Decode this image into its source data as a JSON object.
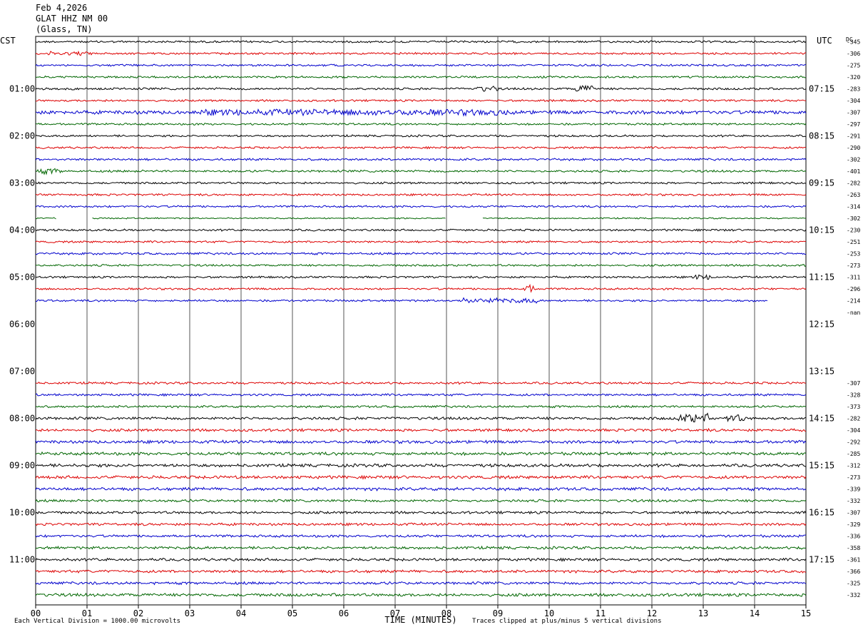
{
  "header": {
    "date": "Feb 4,2026",
    "station": "GLAT HHZ NM 00",
    "location": "(Glass, TN)"
  },
  "left_tz": "CST",
  "right_tz": "UTC",
  "dc_label": "DC",
  "chart_data": {
    "type": "line",
    "title": "",
    "xlabel": "TIME (MINUTES)",
    "x_ticks": [
      "00",
      "01",
      "02",
      "03",
      "04",
      "05",
      "06",
      "07",
      "08",
      "09",
      "10",
      "11",
      "12",
      "13",
      "14",
      "15"
    ],
    "xlim": [
      0,
      15
    ],
    "rows_per_hour": 4,
    "minutes_per_row": 15,
    "left_hour_labels": [
      "01:00",
      "02:00",
      "03:00",
      "04:00",
      "05:00",
      "06:00",
      "07:00",
      "08:00",
      "09:00",
      "10:00",
      "11:00"
    ],
    "right_hour_labels": [
      "07:15",
      "08:15",
      "09:15",
      "10:15",
      "11:15",
      "12:15",
      "13:15",
      "14:15",
      "15:15",
      "16:15",
      "17:15"
    ],
    "trace_colors": [
      "#000000",
      "#dd0000",
      "#0000cc",
      "#006600"
    ],
    "rows": [
      {
        "dc": "-345",
        "color": "#000000",
        "amp": 1.2,
        "end": 15
      },
      {
        "dc": "-306",
        "color": "#dd0000",
        "amp": 1.2,
        "end": 15,
        "events": [
          [
            0.6,
            0.5,
            2.0
          ]
        ]
      },
      {
        "dc": "-275",
        "color": "#0000cc",
        "amp": 1.2,
        "end": 15
      },
      {
        "dc": "-320",
        "color": "#006600",
        "amp": 1.2,
        "end": 15
      },
      {
        "dc": "-283",
        "color": "#000000",
        "amp": 1.3,
        "end": 15,
        "events": [
          [
            8.8,
            0.2,
            2.5
          ],
          [
            10.7,
            0.2,
            3.5
          ]
        ]
      },
      {
        "dc": "-304",
        "color": "#dd0000",
        "amp": 1.2,
        "end": 15
      },
      {
        "dc": "-307",
        "color": "#0000cc",
        "amp": 2.2,
        "end": 15,
        "events": [
          [
            6.2,
            3.0,
            1.7
          ]
        ]
      },
      {
        "dc": "-297",
        "color": "#006600",
        "amp": 1.2,
        "end": 15
      },
      {
        "dc": "-291",
        "color": "#000000",
        "amp": 1.2,
        "end": 15
      },
      {
        "dc": "-290",
        "color": "#dd0000",
        "amp": 1.2,
        "end": 15
      },
      {
        "dc": "-302",
        "color": "#0000cc",
        "amp": 1.3,
        "end": 15
      },
      {
        "dc": "-401",
        "color": "#006600",
        "amp": 1.3,
        "end": 15,
        "events": [
          [
            0.2,
            0.3,
            2.5
          ]
        ]
      },
      {
        "dc": "-282",
        "color": "#000000",
        "amp": 1.2,
        "end": 15
      },
      {
        "dc": "-263",
        "color": "#dd0000",
        "amp": 1.2,
        "end": 15
      },
      {
        "dc": "-314",
        "color": "#0000cc",
        "amp": 1.2,
        "end": 15
      },
      {
        "dc": "-302",
        "color": "#006600",
        "amp": 0.8,
        "end": 15,
        "gaps": [
          [
            0.4,
            1.1
          ],
          [
            8.0,
            8.7
          ]
        ]
      },
      {
        "dc": "-230",
        "color": "#000000",
        "amp": 1.2,
        "end": 15
      },
      {
        "dc": "-251",
        "color": "#dd0000",
        "amp": 1.2,
        "end": 15
      },
      {
        "dc": "-253",
        "color": "#0000cc",
        "amp": 1.3,
        "end": 15
      },
      {
        "dc": "-273",
        "color": "#006600",
        "amp": 1.2,
        "end": 15
      },
      {
        "dc": "-311",
        "color": "#000000",
        "amp": 1.2,
        "end": 15,
        "events": [
          [
            13.0,
            0.2,
            2.5
          ]
        ]
      },
      {
        "dc": "-296",
        "color": "#dd0000",
        "amp": 1.2,
        "end": 15,
        "events": [
          [
            9.6,
            0.1,
            4.0
          ]
        ]
      },
      {
        "dc": "-214",
        "color": "#0000cc",
        "amp": 1.2,
        "end": 14.25,
        "events": [
          [
            9.0,
            0.8,
            2.5
          ]
        ]
      },
      {
        "dc": "-nan",
        "color": "#006600",
        "amp": 0,
        "end": 0
      },
      {
        "dc": "",
        "color": "#000000",
        "amp": 0,
        "end": 0
      },
      {
        "dc": "",
        "color": "#dd0000",
        "amp": 0,
        "end": 0
      },
      {
        "dc": "",
        "color": "#0000cc",
        "amp": 0,
        "end": 0
      },
      {
        "dc": "",
        "color": "#006600",
        "amp": 0,
        "end": 0
      },
      {
        "dc": "",
        "color": "#000000",
        "amp": 0,
        "end": 0
      },
      {
        "dc": "-307",
        "color": "#dd0000",
        "amp": 1.3,
        "end": 15
      },
      {
        "dc": "-328",
        "color": "#0000cc",
        "amp": 1.3,
        "end": 15
      },
      {
        "dc": "-373",
        "color": "#006600",
        "amp": 1.3,
        "end": 15
      },
      {
        "dc": "-282",
        "color": "#000000",
        "amp": 1.6,
        "end": 15,
        "events": [
          [
            12.8,
            0.3,
            3.5
          ],
          [
            13.6,
            0.2,
            3.0
          ]
        ]
      },
      {
        "dc": "-304",
        "color": "#dd0000",
        "amp": 1.6,
        "end": 15
      },
      {
        "dc": "-292",
        "color": "#0000cc",
        "amp": 1.8,
        "end": 15
      },
      {
        "dc": "-285",
        "color": "#006600",
        "amp": 1.8,
        "end": 15
      },
      {
        "dc": "-312",
        "color": "#000000",
        "amp": 1.8,
        "end": 15
      },
      {
        "dc": "-273",
        "color": "#dd0000",
        "amp": 1.8,
        "end": 15
      },
      {
        "dc": "-339",
        "color": "#0000cc",
        "amp": 1.8,
        "end": 15
      },
      {
        "dc": "-332",
        "color": "#006600",
        "amp": 1.5,
        "end": 15
      },
      {
        "dc": "-307",
        "color": "#000000",
        "amp": 1.5,
        "end": 15
      },
      {
        "dc": "-329",
        "color": "#dd0000",
        "amp": 1.5,
        "end": 15
      },
      {
        "dc": "-336",
        "color": "#0000cc",
        "amp": 1.5,
        "end": 15
      },
      {
        "dc": "-358",
        "color": "#006600",
        "amp": 1.6,
        "end": 15
      },
      {
        "dc": "-361",
        "color": "#000000",
        "amp": 1.6,
        "end": 15
      },
      {
        "dc": "-366",
        "color": "#dd0000",
        "amp": 1.6,
        "end": 15
      },
      {
        "dc": "-325",
        "color": "#0000cc",
        "amp": 1.6,
        "end": 15
      },
      {
        "dc": "-332",
        "color": "#006600",
        "amp": 1.8,
        "end": 15
      }
    ]
  },
  "footer": {
    "division": "Each Vertical Division = 1000.00 microvolts",
    "clip": "Traces clipped at plus/minus 5 vertical divisions"
  }
}
